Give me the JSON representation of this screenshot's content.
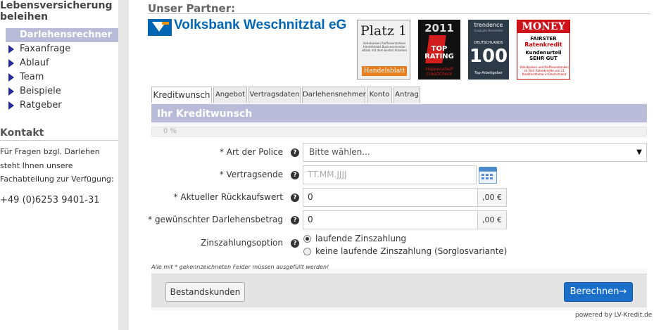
{
  "sidebar": {
    "heading_line1": "Lebensversicherung",
    "heading_line2": "beleihen",
    "items": [
      {
        "label": "Darlehensrechner",
        "active": true
      },
      {
        "label": "Faxanfrage"
      },
      {
        "label": "Ablauf"
      },
      {
        "label": "Team"
      },
      {
        "label": "Beispiele"
      },
      {
        "label": "Ratgeber"
      }
    ],
    "contact_title": "Kontakt",
    "contact_text": "Für Fragen bzgl. Darlehen steht Ihnen unsere Fachabteilung zur Verfügung:",
    "phone": "+49 (0)6253 9401-31"
  },
  "partner": {
    "title": "Unser Partner:",
    "logo_text": "Volksbank Weschnitztal eG",
    "badges": {
      "platz": {
        "big": "Platz 1",
        "small": "Volksbanken Raiffeisenbanken Handelsblatt Businessmonitor eBank mit dem besten Ansehen",
        "footer": "Handelsblatt"
      },
      "top": {
        "year": "2011",
        "line1": "TOP",
        "line2": "RATING",
        "brand": "Hoppenstedt CreditCheck"
      },
      "trend": {
        "brand": "trendence",
        "sub": "Graduate Barometer",
        "country": "DEUTSCHLANDS",
        "number": "100",
        "footer": "Top-Arbeitgeber"
      },
      "money": {
        "brand": "MONEY",
        "l1": "FAIRSTER",
        "l2": "Ratenkredit",
        "l3": "Kundenurteil",
        "l4": "SEHR GUT",
        "footnote": "Volksbanken und Raiffeisenbanken im Test: Ratenkredite von 11 Kreditinstituten in Deutschland"
      }
    }
  },
  "tabs": [
    "Kreditwunsch",
    "Angebot",
    "Vertragsdaten",
    "Darlehensnehmer",
    "Konto",
    "Antrag"
  ],
  "form": {
    "header": "Ihr Kreditwunsch",
    "progress_text": "0 %",
    "fields": {
      "police_label": "* Art der Police",
      "police_value": "Bitte wählen...",
      "vertragsende_label": "* Vertragsende",
      "vertragsende_placeholder": "TT.MM.JJJJ",
      "rueckkauf_label": "* Aktueller Rückkaufswert",
      "rueckkauf_value": "0",
      "rueckkauf_suffix": ",00 €",
      "betrag_label": "* gewünschter Darlehensbetrag",
      "betrag_value": "0",
      "betrag_suffix": ",00 €",
      "zins_label": "Zinszahlungsoption",
      "zins_option1": "laufende Zinszahlung",
      "zins_option2": "keine laufende Zinszahlung (Sorglosvariante)"
    },
    "help_icon": "?",
    "note": "Alle mit * gekennzeichneten Felder müssen ausgefüllt werden!",
    "btn_bestand": "Bestandskunden",
    "btn_berechnen": "Berechnen→"
  },
  "footer": {
    "powered": "powered by LV-Kredit.de"
  }
}
